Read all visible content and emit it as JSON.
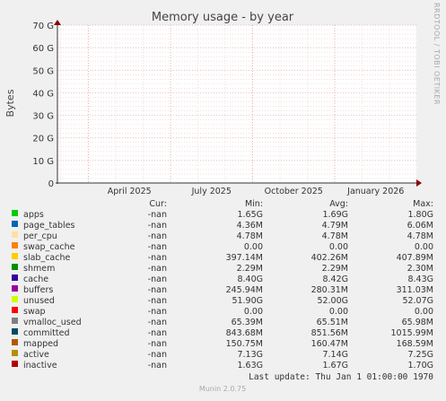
{
  "chart_data": {
    "type": "line",
    "title": "Memory usage - by year",
    "ylabel": "Bytes",
    "xlabel": "",
    "ylim": [
      0,
      70
    ],
    "y_unit": "G",
    "y_ticks": [
      "0",
      "10 G",
      "20 G",
      "30 G",
      "40 G",
      "50 G",
      "60 G",
      "70 G"
    ],
    "x_ticks": [
      "April 2025",
      "July 2025",
      "October 2025",
      "January 2026"
    ],
    "grid": true,
    "watermark": "RRDTOOL / TOBI OETIKER",
    "legend_headers": {
      "cur": "Cur:",
      "min": "Min:",
      "avg": "Avg:",
      "max": "Max:"
    },
    "series": [
      {
        "name": "apps",
        "color": "#00cc00",
        "cur": "-nan",
        "min": "1.65G",
        "avg": "1.69G",
        "max": "1.80G"
      },
      {
        "name": "page_tables",
        "color": "#0066b3",
        "cur": "-nan",
        "min": "4.36M",
        "avg": "4.79M",
        "max": "6.06M"
      },
      {
        "name": "per_cpu",
        "color": "#ffe0a0",
        "cur": "-nan",
        "min": "4.78M",
        "avg": "4.78M",
        "max": "4.78M"
      },
      {
        "name": "swap_cache",
        "color": "#ff8000",
        "cur": "-nan",
        "min": "0.00",
        "avg": "0.00",
        "max": "0.00"
      },
      {
        "name": "slab_cache",
        "color": "#ffcc00",
        "cur": "-nan",
        "min": "397.14M",
        "avg": "402.26M",
        "max": "407.89M"
      },
      {
        "name": "shmem",
        "color": "#008f00",
        "cur": "-nan",
        "min": "2.29M",
        "avg": "2.29M",
        "max": "2.30M"
      },
      {
        "name": "cache",
        "color": "#330099",
        "cur": "-nan",
        "min": "8.40G",
        "avg": "8.42G",
        "max": "8.43G"
      },
      {
        "name": "buffers",
        "color": "#990099",
        "cur": "-nan",
        "min": "245.94M",
        "avg": "280.31M",
        "max": "311.03M"
      },
      {
        "name": "unused",
        "color": "#ccff00",
        "cur": "-nan",
        "min": "51.90G",
        "avg": "52.00G",
        "max": "52.07G"
      },
      {
        "name": "swap",
        "color": "#ff0000",
        "cur": "-nan",
        "min": "0.00",
        "avg": "0.00",
        "max": "0.00"
      },
      {
        "name": "vmalloc_used",
        "color": "#808080",
        "cur": "-nan",
        "min": "65.39M",
        "avg": "65.51M",
        "max": "65.98M"
      },
      {
        "name": "committed",
        "color": "#004d66",
        "cur": "-nan",
        "min": "843.68M",
        "avg": "851.56M",
        "max": "1015.99M"
      },
      {
        "name": "mapped",
        "color": "#b35a00",
        "cur": "-nan",
        "min": "150.75M",
        "avg": "160.47M",
        "max": "168.59M"
      },
      {
        "name": "active",
        "color": "#b38f00",
        "cur": "-nan",
        "min": "7.13G",
        "avg": "7.14G",
        "max": "7.25G"
      },
      {
        "name": "inactive",
        "color": "#b30000",
        "cur": "-nan",
        "min": "1.63G",
        "avg": "1.67G",
        "max": "1.70G"
      }
    ],
    "last_update": "Last update: Thu Jan  1 01:00:00 1970",
    "footer": "Munin 2.0.75"
  }
}
